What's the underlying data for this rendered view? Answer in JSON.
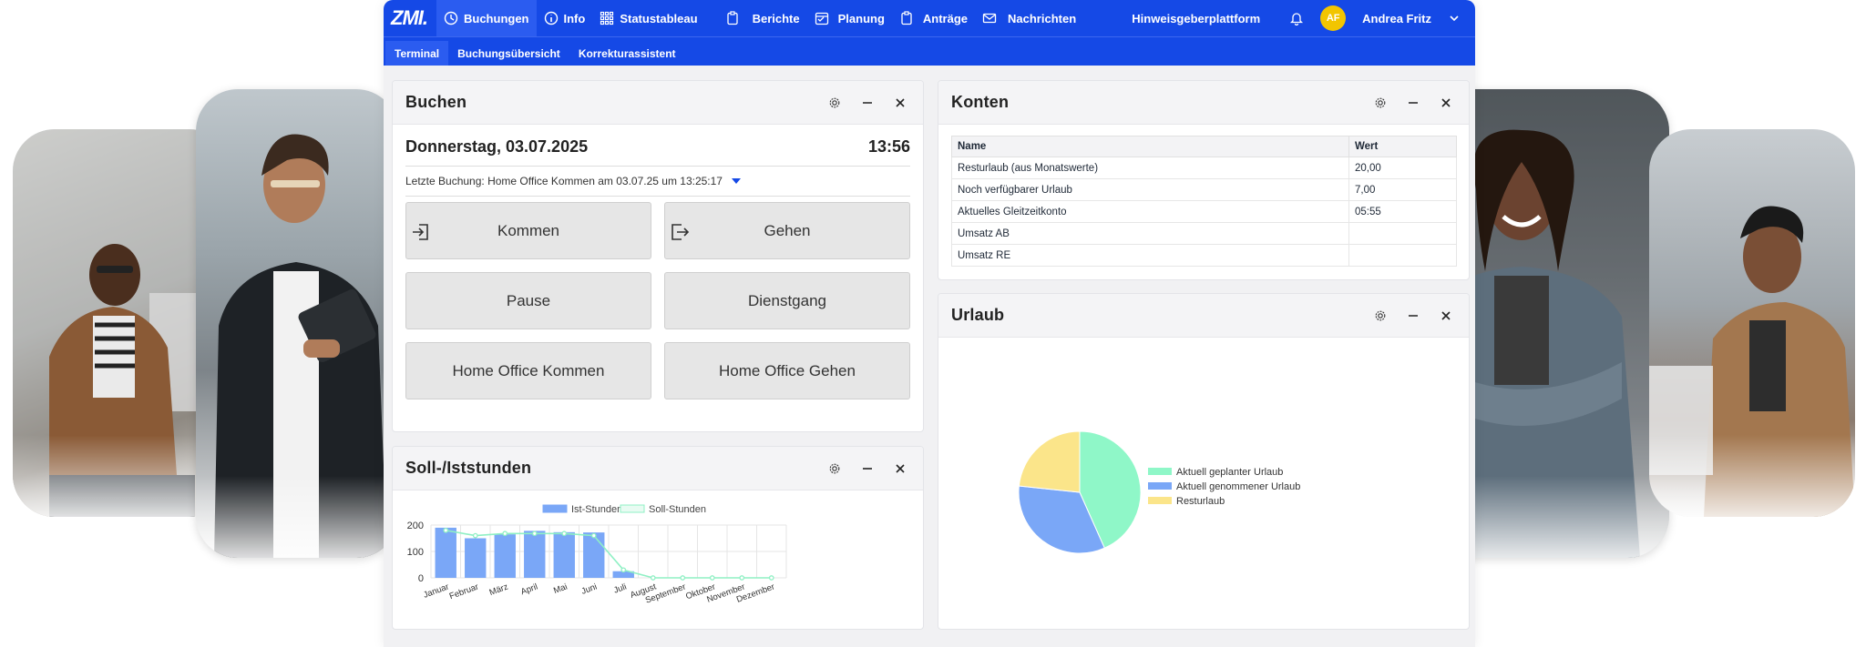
{
  "app": {
    "logo": "ZMI.",
    "nav": [
      {
        "label": "Buchungen",
        "icon": "clock-icon"
      },
      {
        "label": "Info",
        "icon": "info-icon"
      },
      {
        "label": "Statustableau",
        "icon": "grid-icon"
      },
      {
        "label": "Berichte",
        "icon": "clipboard-icon"
      },
      {
        "label": "Planung",
        "icon": "calendar-icon"
      },
      {
        "label": "Anträge",
        "icon": "clipboard-icon"
      },
      {
        "label": "Nachrichten",
        "icon": "mail-icon"
      }
    ],
    "hinweis": "Hinweisgeberplattform",
    "avatar_initials": "AF",
    "user_name": "Andrea Fritz",
    "subnav": [
      "Terminal",
      "Buchungsübersicht",
      "Korrekturassistent"
    ]
  },
  "buchen": {
    "title": "Buchen",
    "date": "Donnerstag, 03.07.2025",
    "time": "13:56",
    "last_booking": "Letzte Buchung: Home Office Kommen am 03.07.25 um 13:25:17",
    "buttons": [
      "Kommen",
      "Gehen",
      "Pause",
      "Dienstgang",
      "Home Office Kommen",
      "Home Office Gehen"
    ]
  },
  "konten": {
    "title": "Konten",
    "headers": [
      "Name",
      "Wert"
    ],
    "rows": [
      [
        "Resturlaub (aus Monatswerte)",
        "20,00"
      ],
      [
        "Noch verfügbarer Urlaub",
        "7,00"
      ],
      [
        "Aktuelles Gleitzeitkonto",
        "05:55"
      ],
      [
        "Umsatz AB",
        ""
      ],
      [
        "Umsatz RE",
        ""
      ]
    ]
  },
  "urlaub": {
    "title": "Urlaub"
  },
  "soll": {
    "title": "Soll-/Iststunden"
  },
  "colors": {
    "brand": "#1549e6",
    "bar": "#7aa7f7",
    "line": "#8ff0c4",
    "pie_green": "#8ff7c8",
    "pie_blue": "#7aa7f7",
    "pie_yellow": "#fbe58a"
  },
  "chart_data": [
    {
      "type": "bar",
      "categories": [
        "Januar",
        "Februar",
        "März",
        "April",
        "Mai",
        "Juni",
        "Juli",
        "August",
        "September",
        "Oktober",
        "November",
        "Dezember"
      ],
      "series": [
        {
          "name": "Ist-Stunden",
          "values": [
            190,
            150,
            165,
            178,
            173,
            172,
            25,
            0,
            0,
            0,
            0,
            0
          ]
        },
        {
          "name": "Soll-Stunden",
          "values": [
            180,
            160,
            168,
            168,
            168,
            160,
            30,
            0,
            0,
            0,
            0,
            0
          ]
        }
      ],
      "ylim": [
        0,
        200
      ],
      "yticks": [
        0,
        100,
        200
      ],
      "legend": "top-center",
      "grid": true
    },
    {
      "type": "pie",
      "labels": [
        "Aktuell geplanter Urlaub",
        "Aktuell genommener Urlaub",
        "Resturlaub"
      ],
      "values": [
        13,
        10,
        7
      ],
      "legend": "right"
    }
  ]
}
